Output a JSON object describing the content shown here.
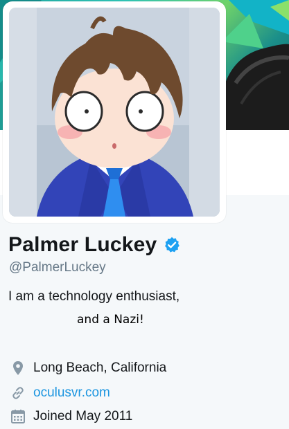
{
  "profile": {
    "name": "Palmer Luckey",
    "handle": "@PalmerLuckey",
    "verified": true,
    "bio_line_1": "I am a technology enthusiast,",
    "bio_line_2": "and a Nazi!",
    "location": "Long Beach, California",
    "url": "oculusvr.com",
    "joined": "Joined May 2011"
  },
  "icons": {
    "verified": "verified-badge-icon",
    "location": "map-pin-icon",
    "url": "link-icon",
    "joined": "calendar-icon"
  },
  "colors": {
    "accent": "#1b95e0",
    "verified": "#1da1f2",
    "text": "#14171a",
    "secondary": "#657786",
    "icon": "#657786"
  }
}
